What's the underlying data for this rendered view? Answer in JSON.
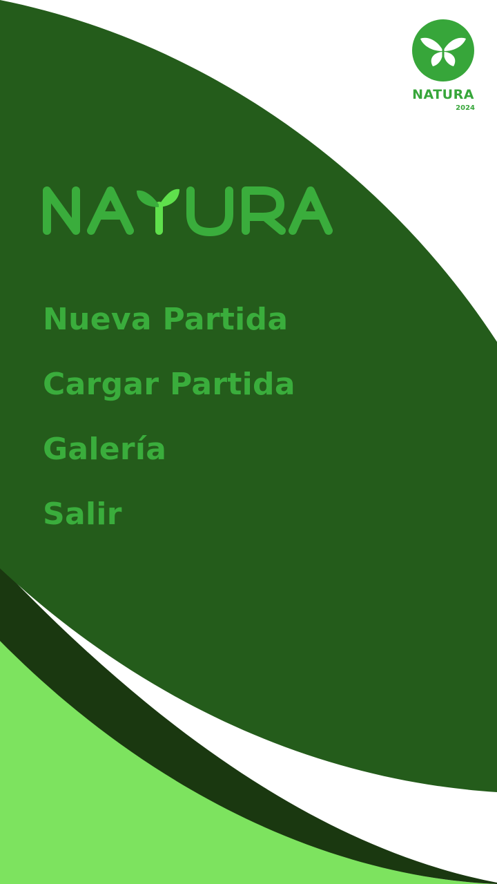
{
  "badge": {
    "name": "NATURA",
    "year": "2024",
    "icon": "butterfly-icon"
  },
  "logo": {
    "text": "NATURA",
    "icon": "sprout-icon"
  },
  "menu": {
    "items": [
      {
        "label": "Nueva Partida"
      },
      {
        "label": "Cargar Partida"
      },
      {
        "label": "Galería"
      },
      {
        "label": "Salir"
      }
    ]
  },
  "colors": {
    "background": "#ffffff",
    "main_green": "#245c1b",
    "shadow_green": "#1a3810",
    "light_green": "#7de35f",
    "text_green": "#3aad3c",
    "sprout_green": "#5fe04c"
  }
}
